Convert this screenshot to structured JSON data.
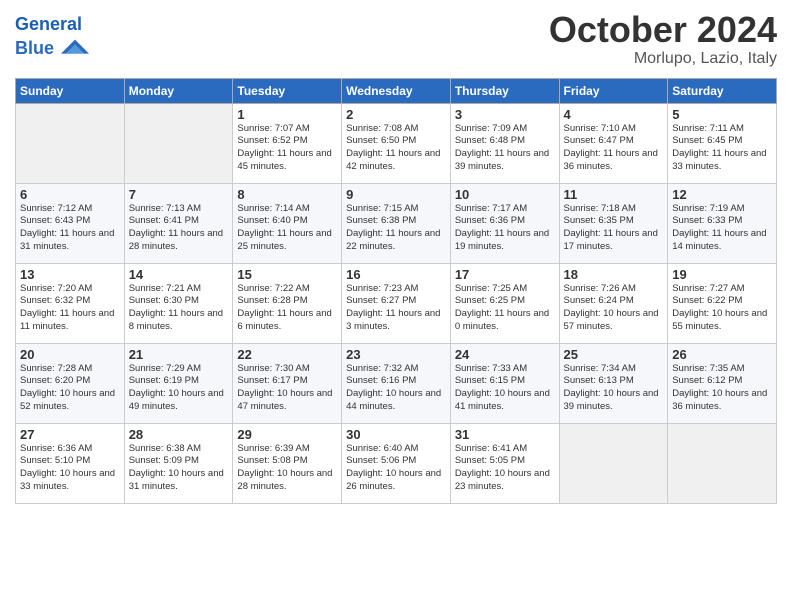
{
  "header": {
    "logo_line1": "General",
    "logo_line2": "Blue",
    "month": "October 2024",
    "location": "Morlupo, Lazio, Italy"
  },
  "days_of_week": [
    "Sunday",
    "Monday",
    "Tuesday",
    "Wednesday",
    "Thursday",
    "Friday",
    "Saturday"
  ],
  "weeks": [
    [
      {
        "day": "",
        "empty": true
      },
      {
        "day": "",
        "empty": true
      },
      {
        "day": "1",
        "sunrise": "Sunrise: 7:07 AM",
        "sunset": "Sunset: 6:52 PM",
        "daylight": "Daylight: 11 hours and 45 minutes."
      },
      {
        "day": "2",
        "sunrise": "Sunrise: 7:08 AM",
        "sunset": "Sunset: 6:50 PM",
        "daylight": "Daylight: 11 hours and 42 minutes."
      },
      {
        "day": "3",
        "sunrise": "Sunrise: 7:09 AM",
        "sunset": "Sunset: 6:48 PM",
        "daylight": "Daylight: 11 hours and 39 minutes."
      },
      {
        "day": "4",
        "sunrise": "Sunrise: 7:10 AM",
        "sunset": "Sunset: 6:47 PM",
        "daylight": "Daylight: 11 hours and 36 minutes."
      },
      {
        "day": "5",
        "sunrise": "Sunrise: 7:11 AM",
        "sunset": "Sunset: 6:45 PM",
        "daylight": "Daylight: 11 hours and 33 minutes."
      }
    ],
    [
      {
        "day": "6",
        "sunrise": "Sunrise: 7:12 AM",
        "sunset": "Sunset: 6:43 PM",
        "daylight": "Daylight: 11 hours and 31 minutes."
      },
      {
        "day": "7",
        "sunrise": "Sunrise: 7:13 AM",
        "sunset": "Sunset: 6:41 PM",
        "daylight": "Daylight: 11 hours and 28 minutes."
      },
      {
        "day": "8",
        "sunrise": "Sunrise: 7:14 AM",
        "sunset": "Sunset: 6:40 PM",
        "daylight": "Daylight: 11 hours and 25 minutes."
      },
      {
        "day": "9",
        "sunrise": "Sunrise: 7:15 AM",
        "sunset": "Sunset: 6:38 PM",
        "daylight": "Daylight: 11 hours and 22 minutes."
      },
      {
        "day": "10",
        "sunrise": "Sunrise: 7:17 AM",
        "sunset": "Sunset: 6:36 PM",
        "daylight": "Daylight: 11 hours and 19 minutes."
      },
      {
        "day": "11",
        "sunrise": "Sunrise: 7:18 AM",
        "sunset": "Sunset: 6:35 PM",
        "daylight": "Daylight: 11 hours and 17 minutes."
      },
      {
        "day": "12",
        "sunrise": "Sunrise: 7:19 AM",
        "sunset": "Sunset: 6:33 PM",
        "daylight": "Daylight: 11 hours and 14 minutes."
      }
    ],
    [
      {
        "day": "13",
        "sunrise": "Sunrise: 7:20 AM",
        "sunset": "Sunset: 6:32 PM",
        "daylight": "Daylight: 11 hours and 11 minutes."
      },
      {
        "day": "14",
        "sunrise": "Sunrise: 7:21 AM",
        "sunset": "Sunset: 6:30 PM",
        "daylight": "Daylight: 11 hours and 8 minutes."
      },
      {
        "day": "15",
        "sunrise": "Sunrise: 7:22 AM",
        "sunset": "Sunset: 6:28 PM",
        "daylight": "Daylight: 11 hours and 6 minutes."
      },
      {
        "day": "16",
        "sunrise": "Sunrise: 7:23 AM",
        "sunset": "Sunset: 6:27 PM",
        "daylight": "Daylight: 11 hours and 3 minutes."
      },
      {
        "day": "17",
        "sunrise": "Sunrise: 7:25 AM",
        "sunset": "Sunset: 6:25 PM",
        "daylight": "Daylight: 11 hours and 0 minutes."
      },
      {
        "day": "18",
        "sunrise": "Sunrise: 7:26 AM",
        "sunset": "Sunset: 6:24 PM",
        "daylight": "Daylight: 10 hours and 57 minutes."
      },
      {
        "day": "19",
        "sunrise": "Sunrise: 7:27 AM",
        "sunset": "Sunset: 6:22 PM",
        "daylight": "Daylight: 10 hours and 55 minutes."
      }
    ],
    [
      {
        "day": "20",
        "sunrise": "Sunrise: 7:28 AM",
        "sunset": "Sunset: 6:20 PM",
        "daylight": "Daylight: 10 hours and 52 minutes."
      },
      {
        "day": "21",
        "sunrise": "Sunrise: 7:29 AM",
        "sunset": "Sunset: 6:19 PM",
        "daylight": "Daylight: 10 hours and 49 minutes."
      },
      {
        "day": "22",
        "sunrise": "Sunrise: 7:30 AM",
        "sunset": "Sunset: 6:17 PM",
        "daylight": "Daylight: 10 hours and 47 minutes."
      },
      {
        "day": "23",
        "sunrise": "Sunrise: 7:32 AM",
        "sunset": "Sunset: 6:16 PM",
        "daylight": "Daylight: 10 hours and 44 minutes."
      },
      {
        "day": "24",
        "sunrise": "Sunrise: 7:33 AM",
        "sunset": "Sunset: 6:15 PM",
        "daylight": "Daylight: 10 hours and 41 minutes."
      },
      {
        "day": "25",
        "sunrise": "Sunrise: 7:34 AM",
        "sunset": "Sunset: 6:13 PM",
        "daylight": "Daylight: 10 hours and 39 minutes."
      },
      {
        "day": "26",
        "sunrise": "Sunrise: 7:35 AM",
        "sunset": "Sunset: 6:12 PM",
        "daylight": "Daylight: 10 hours and 36 minutes."
      }
    ],
    [
      {
        "day": "27",
        "sunrise": "Sunrise: 6:36 AM",
        "sunset": "Sunset: 5:10 PM",
        "daylight": "Daylight: 10 hours and 33 minutes."
      },
      {
        "day": "28",
        "sunrise": "Sunrise: 6:38 AM",
        "sunset": "Sunset: 5:09 PM",
        "daylight": "Daylight: 10 hours and 31 minutes."
      },
      {
        "day": "29",
        "sunrise": "Sunrise: 6:39 AM",
        "sunset": "Sunset: 5:08 PM",
        "daylight": "Daylight: 10 hours and 28 minutes."
      },
      {
        "day": "30",
        "sunrise": "Sunrise: 6:40 AM",
        "sunset": "Sunset: 5:06 PM",
        "daylight": "Daylight: 10 hours and 26 minutes."
      },
      {
        "day": "31",
        "sunrise": "Sunrise: 6:41 AM",
        "sunset": "Sunset: 5:05 PM",
        "daylight": "Daylight: 10 hours and 23 minutes."
      },
      {
        "day": "",
        "empty": true
      },
      {
        "day": "",
        "empty": true
      }
    ]
  ]
}
